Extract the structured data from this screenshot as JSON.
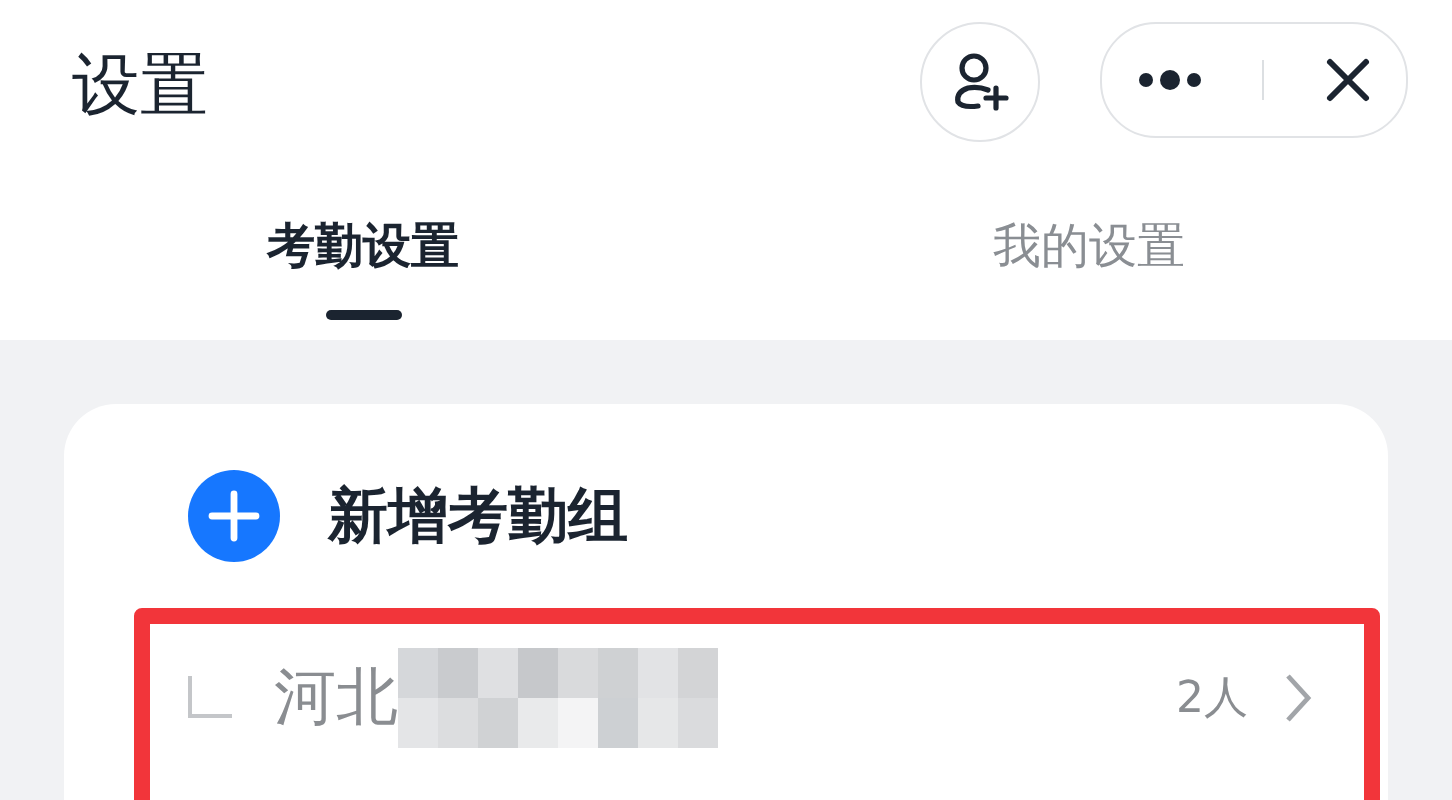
{
  "window": {
    "title": "设置"
  },
  "tabs": [
    {
      "label": "考勤设置",
      "selected": true
    },
    {
      "label": "我的设置",
      "selected": false
    }
  ],
  "add_group": {
    "label": "新增考勤组"
  },
  "groups": [
    {
      "name": "河北",
      "count": "2人",
      "highlighted": true
    }
  ]
}
